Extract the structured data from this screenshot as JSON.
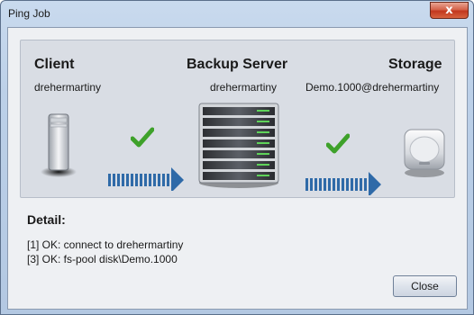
{
  "window": {
    "title": "Ping Job",
    "close_glyph": "x"
  },
  "client": {
    "title": "Client",
    "name": "drehermartiny"
  },
  "server": {
    "title": "Backup Server",
    "name": "drehermartiny"
  },
  "storage": {
    "title": "Storage",
    "name": "Demo.1000@drehermartiny"
  },
  "links": [
    {
      "status": "ok",
      "icon": "green-checkmark-icon"
    },
    {
      "status": "ok",
      "icon": "green-checkmark-icon"
    }
  ],
  "detail": {
    "title": "Detail:",
    "lines": [
      "[1] OK: connect to drehermartiny",
      "[3] OK: fs-pool disk\\Demo.1000"
    ]
  },
  "buttons": {
    "close": "Close"
  },
  "colors": {
    "arrow": "#2f6aa8",
    "check": "#3ea12a",
    "panel": "#d9dde4"
  }
}
